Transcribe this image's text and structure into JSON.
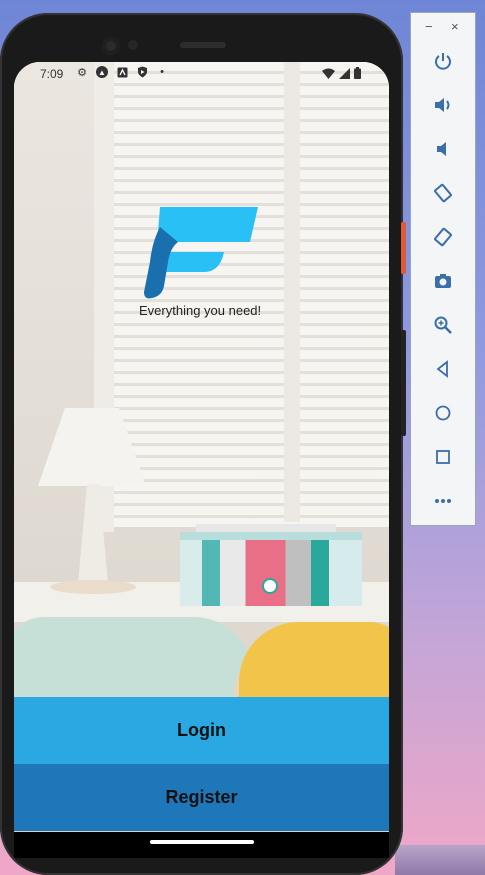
{
  "status_bar": {
    "time": "7:09"
  },
  "app": {
    "tagline": "Everything you need!",
    "login_label": "Login",
    "register_label": "Register",
    "colors": {
      "login_bg": "#29a8e1",
      "register_bg": "#1e77b8",
      "logo_light": "#29c0f5",
      "logo_dark": "#1a6fae"
    }
  },
  "emulator_panel": {
    "minimize": "−",
    "close": "×",
    "tools": [
      "power-icon",
      "volume-up-icon",
      "volume-down-icon",
      "rotate-left-icon",
      "rotate-right-icon",
      "camera-icon",
      "zoom-icon",
      "back-icon",
      "home-icon",
      "overview-icon",
      "more-icon"
    ]
  }
}
